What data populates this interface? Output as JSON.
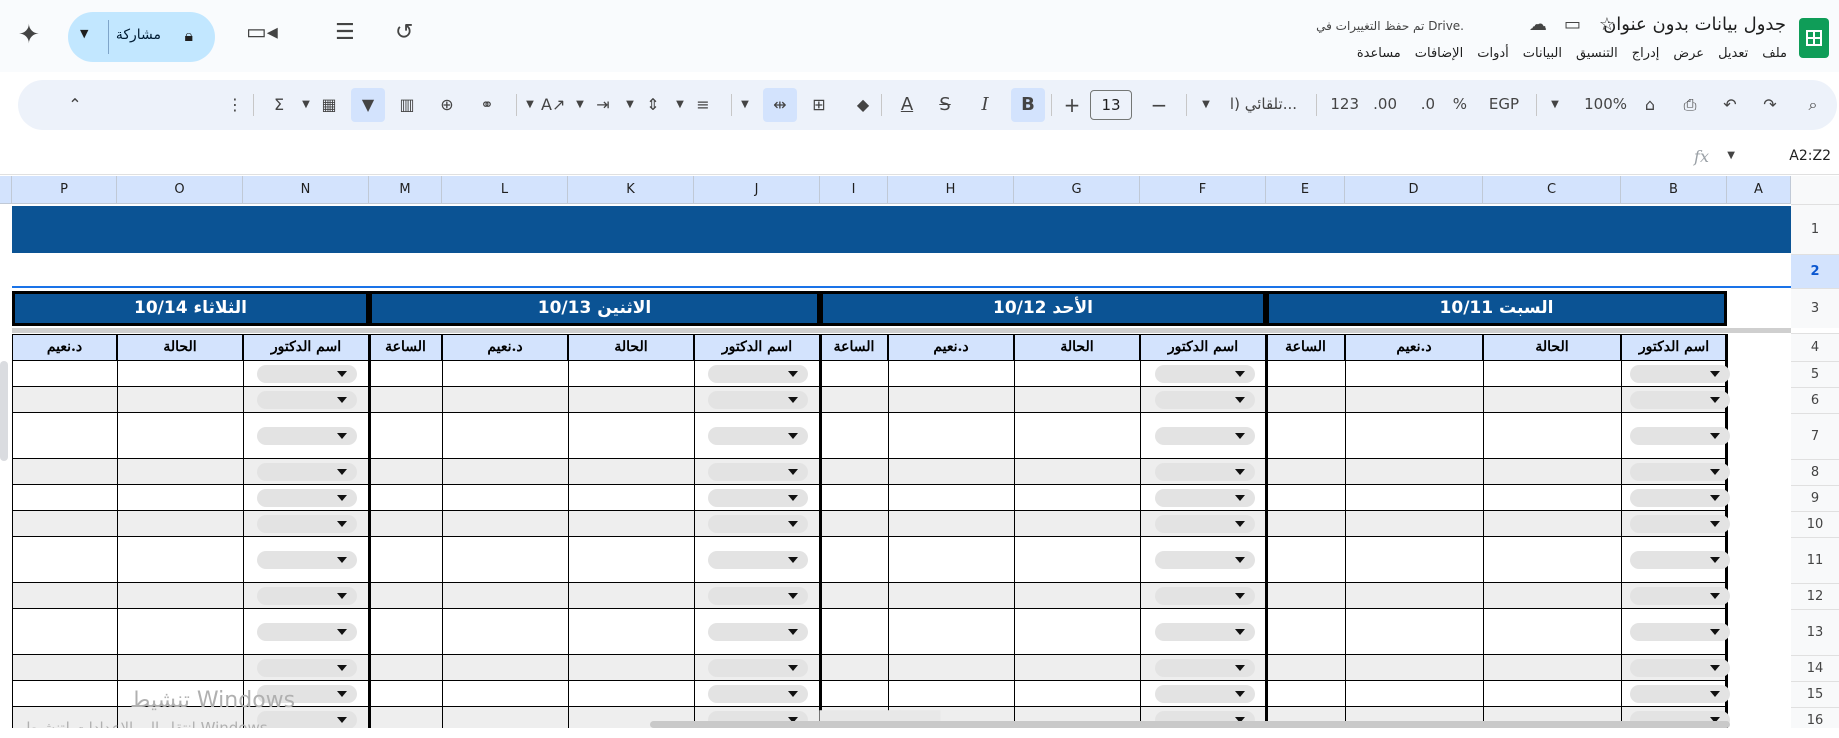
{
  "app": {
    "title": "جدول بيانات بدون عنوان",
    "saved_status": "تم حفظ التغييرات في Drive.",
    "menus": [
      "ملف",
      "تعديل",
      "عرض",
      "إدراج",
      "التنسيق",
      "البيانات",
      "أدوات",
      "الإضافات",
      "مساعدة"
    ],
    "share_label": "مشاركة"
  },
  "toolbar": {
    "zoom": "100%",
    "currency": "EGP",
    "percent": "%",
    "decimal_decrease": ".0",
    "decimal_increase": ".00",
    "number_format": "123",
    "font_name": "تلقائي (ا...",
    "font_size": "13"
  },
  "formula_bar": {
    "name_box": "A2:Z2",
    "fx_label": "fx"
  },
  "grid": {
    "columns": [
      "A",
      "B",
      "C",
      "D",
      "E",
      "F",
      "G",
      "H",
      "I",
      "J",
      "K",
      "L",
      "M",
      "N",
      "O",
      "P"
    ],
    "rows": [
      "1",
      "2",
      "3",
      "4",
      "5",
      "6",
      "7",
      "8",
      "9",
      "10",
      "11",
      "12",
      "13",
      "14",
      "15",
      "16"
    ],
    "selected_row": "2",
    "day_headers": [
      "السبت 10/11",
      "الأحد 10/12",
      "الاثنين 10/13",
      "الثلاثاء 10/14"
    ],
    "sub_headers": {
      "doctor": "اسم الدكتور",
      "status": "الحالة",
      "name": "د.نعيم",
      "hour": "الساعة"
    }
  },
  "overlay": {
    "activation_title": "تنشيط Windows",
    "activation_sub": "انتقل إلى الإعدادات لتنشيط Windows."
  },
  "colors": {
    "header_blue": "#0b5394",
    "subheader_blue": "#d3e3fd",
    "share_blue": "#c2e7ff"
  }
}
